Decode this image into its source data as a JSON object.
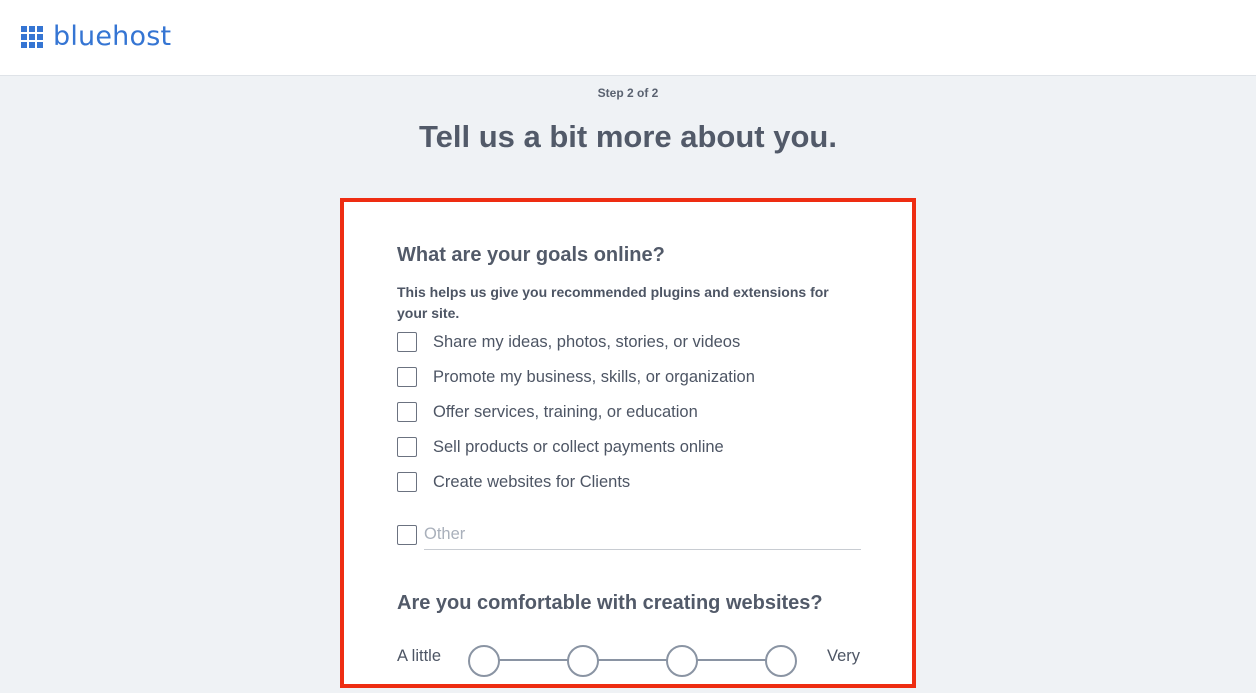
{
  "header": {
    "logo_text": "bluehost",
    "brand_color": "#3575d3"
  },
  "step_label": "Step 2 of 2",
  "headline": "Tell us a bit more about you.",
  "goals": {
    "question": "What are your goals online?",
    "hint": "This helps us give you recommended plugins and extensions for your site.",
    "options": [
      {
        "label": "Share my ideas, photos, stories, or videos",
        "checked": false
      },
      {
        "label": "Promote my business, skills, or organization",
        "checked": false
      },
      {
        "label": "Offer services, training, or education",
        "checked": false
      },
      {
        "label": "Sell products or collect payments online",
        "checked": false
      },
      {
        "label": "Create websites for Clients",
        "checked": false
      }
    ],
    "other": {
      "placeholder": "Other",
      "value": "",
      "checked": false
    }
  },
  "comfort": {
    "question": "Are you comfortable with creating websites?",
    "low_label": "A little",
    "high_label": "Very",
    "levels": 4,
    "selected": null
  },
  "highlight_color": "#ee2d12"
}
